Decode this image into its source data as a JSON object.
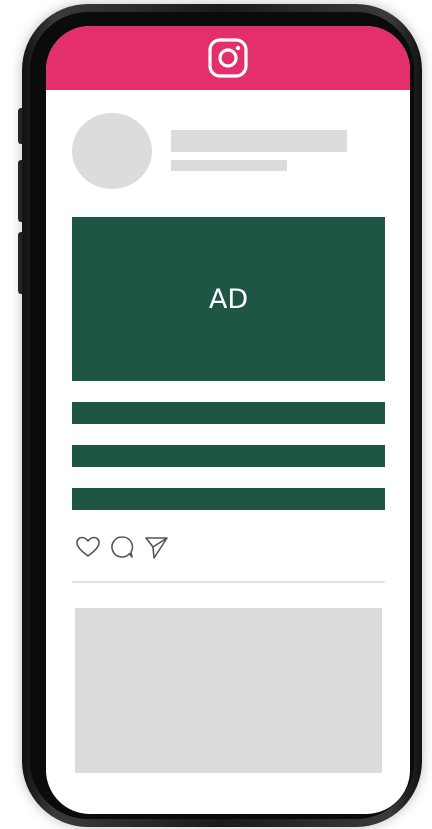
{
  "colors": {
    "header": "#e3306c",
    "ad_background": "#1e5545",
    "text_bar": "#1e5545",
    "placeholder": "#dcdcdc",
    "icon_stroke": "#555555"
  },
  "header": {
    "icon": "instagram-logo-icon"
  },
  "ad": {
    "label": "AD"
  },
  "actions": {
    "icons": [
      "heart-icon",
      "comment-icon",
      "send-icon"
    ]
  }
}
